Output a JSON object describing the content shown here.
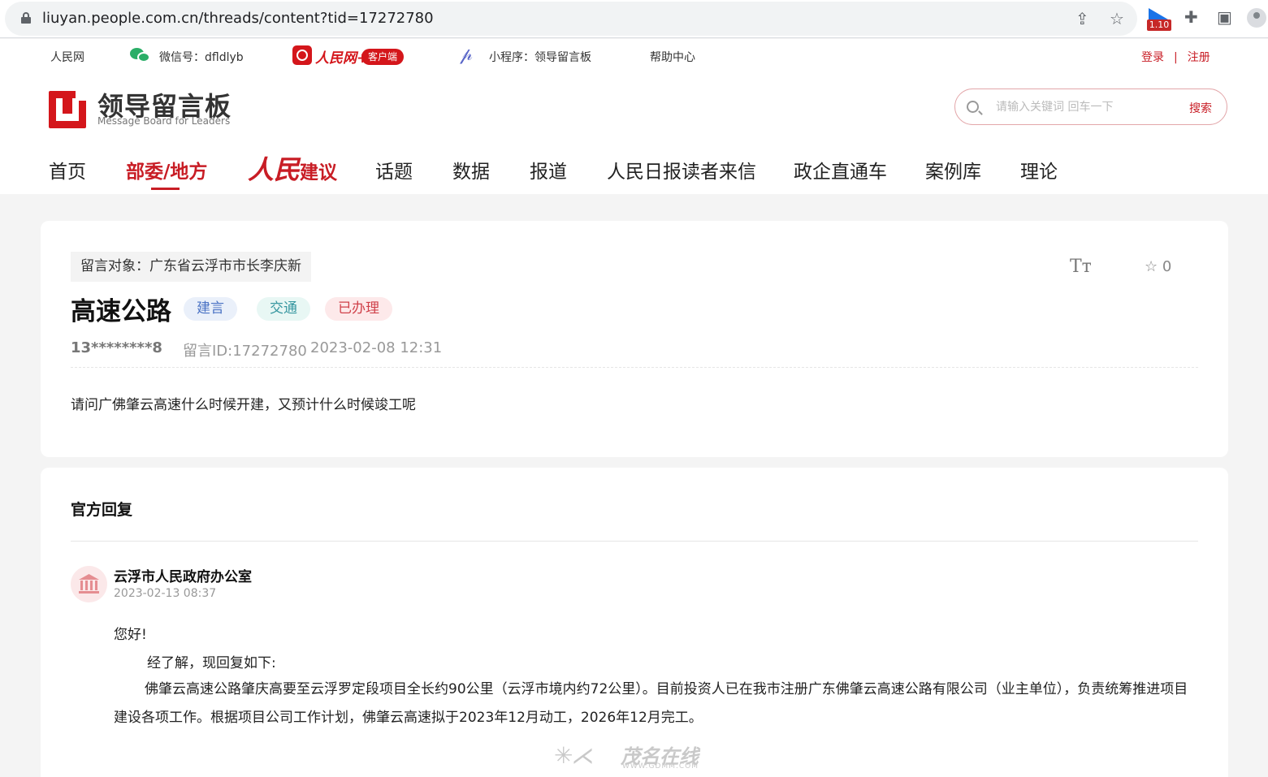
{
  "browser": {
    "url": "liuyan.people.com.cn/threads/content?tid=17272780",
    "extension_badge": "1.10"
  },
  "topbar": {
    "people_site": "人民网",
    "wechat": "微信号：dfldlyb",
    "rmw_logo_text": "人民网+",
    "client_label": "客户端",
    "mini_program": "小程序：领导留言板",
    "help": "帮助中心",
    "login": "登录",
    "separator": "|",
    "register": "注册"
  },
  "logo": {
    "title": "领导留言板",
    "subtitle": "Message Board for Leaders"
  },
  "search": {
    "placeholder": "请输入关键词 回车一下",
    "button": "搜索"
  },
  "nav": {
    "home": "首页",
    "ministry_local": "部委/地方",
    "rmjy_part1": "人民",
    "rmjy_part2": "建议",
    "topics": "话题",
    "data": "数据",
    "reports": "报道",
    "letters": "人民日报读者来信",
    "gov_enterprise": "政企直通车",
    "cases": "案例库",
    "theory": "理论"
  },
  "post": {
    "target": "留言对象：广东省云浮市市长李庆新",
    "font_toggle": "Tт",
    "favorites": "☆ 0",
    "title": "高速公路",
    "tags": {
      "type": "建言",
      "domain": "交通",
      "status": "已办理"
    },
    "user": "13********8",
    "message_id": "留言ID:17272780",
    "datetime": "2023-02-08 12:31",
    "body": "请问广佛肇云高速什么时候开建，又预计什么时候竣工呢"
  },
  "reply": {
    "heading": "官方回复",
    "org": "云浮市人民政府办公室",
    "datetime": "2023-02-13 08:37",
    "greeting": "您好!",
    "intro": "经了解，现回复如下:",
    "paragraph": "佛肇云高速公路肇庆高要至云浮罗定段项目全长约90公里（云浮市境内约72公里）。目前投资人已在我市注册广东佛肇云高速公路有限公司（业主单位），负责统筹推进项目建设各项工作。根据项目公司工作计划，佛肇云高速拟于2023年12月动工，2026年12月完工。"
  },
  "watermark": {
    "text": "茂名在线",
    "url": "WWW.GDMM.COM"
  },
  "colors": {
    "brand_red": "#c81d25",
    "page_bg": "#f4f4f4"
  }
}
